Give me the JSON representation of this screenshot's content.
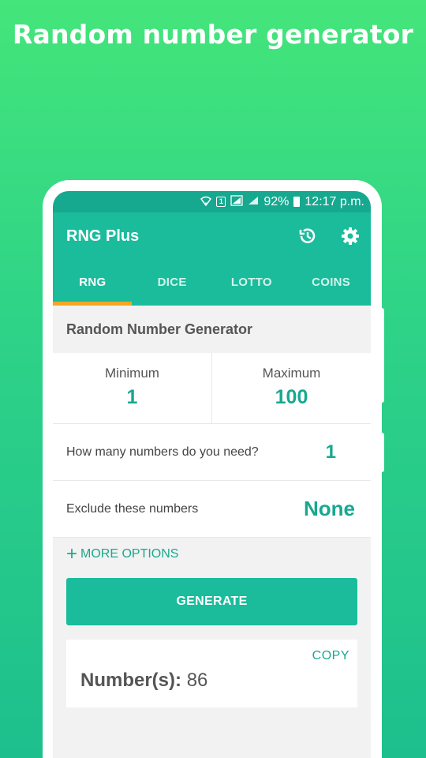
{
  "promo": {
    "headline": "Random number generator"
  },
  "status_bar": {
    "battery": "92%",
    "time": "12:17 p.m.",
    "sim_label": "1"
  },
  "app": {
    "title": "RNG Plus",
    "history_icon": "history-icon",
    "settings_icon": "gear-icon"
  },
  "tabs": [
    {
      "label": "RNG",
      "active": true
    },
    {
      "label": "DICE",
      "active": false
    },
    {
      "label": "LOTTO",
      "active": false
    },
    {
      "label": "COINS",
      "active": false
    }
  ],
  "generator": {
    "section_title": "Random Number Generator",
    "minimum_label": "Minimum",
    "minimum_value": "1",
    "maximum_label": "Maximum",
    "maximum_value": "100",
    "quantity_label": "How many numbers do you need?",
    "quantity_value": "1",
    "exclude_label": "Exclude these numbers",
    "exclude_value": "None",
    "more_options_label": "MORE OPTIONS",
    "generate_label": "GENERATE"
  },
  "result": {
    "copy_label": "COPY",
    "label": "Number(s):",
    "value": "86"
  },
  "colors": {
    "accent": "#1abc9c",
    "accent_dark": "#17a890",
    "tab_indicator": "#f5a623",
    "background_top": "#44e57a"
  }
}
